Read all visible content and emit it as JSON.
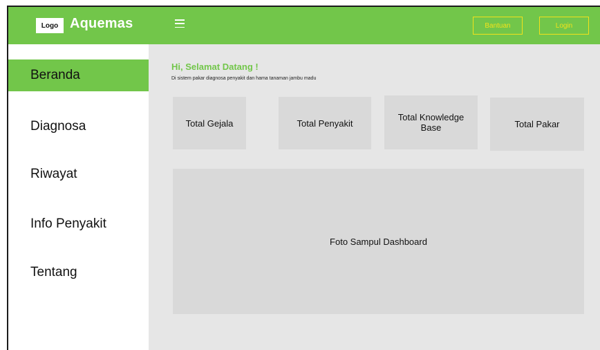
{
  "header": {
    "logo_text": "Logo",
    "app_name": "Aquemas",
    "menu_icon": "hamburger-menu-icon",
    "buttons": {
      "help_label": "Bantuan",
      "login_label": "Login"
    },
    "colors": {
      "accent": "#72c64a",
      "button_outline": "#f2e21a"
    }
  },
  "sidebar": {
    "items": [
      {
        "label": "Beranda",
        "active": true
      },
      {
        "label": "Diagnosa",
        "active": false
      },
      {
        "label": "Riwayat",
        "active": false
      },
      {
        "label": "Info Penyakit",
        "active": false
      },
      {
        "label": "Tentang",
        "active": false
      }
    ]
  },
  "main": {
    "greeting": "Hi, Selamat Datang !",
    "subtitle": "Di sistem pakar diagnosa penyakit dan hama tanaman jambu madu",
    "cards": [
      {
        "label": "Total Gejala"
      },
      {
        "label": "Total Penyakit"
      },
      {
        "label": "Total Knowledge Base"
      },
      {
        "label": "Total Pakar"
      }
    ],
    "cover_label": "Foto Sampul Dashboard"
  }
}
